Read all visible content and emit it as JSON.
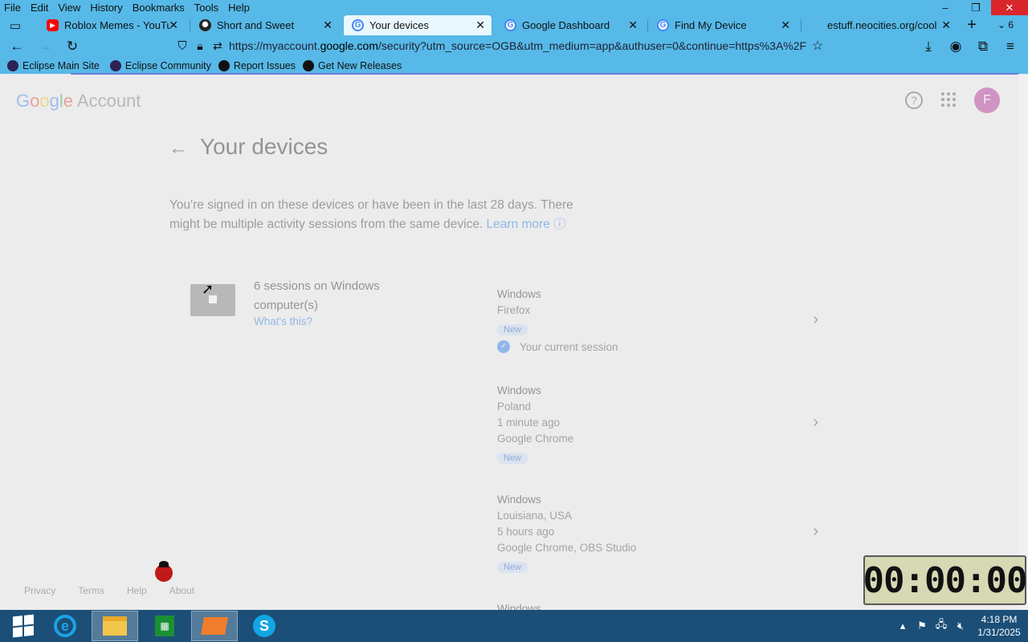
{
  "menubar": [
    "File",
    "Edit",
    "View",
    "History",
    "Bookmarks",
    "Tools",
    "Help"
  ],
  "window_controls": {
    "minimize": "–",
    "restore": "❐",
    "close": "✕"
  },
  "tabs": [
    {
      "label": "Roblox Memes - YouTube",
      "icon": "youtube-icon"
    },
    {
      "label": "Short and Sweet",
      "icon": "ai-icon"
    },
    {
      "label": "Your devices",
      "icon": "google-icon",
      "active": true
    },
    {
      "label": "Google Dashboard",
      "icon": "google-icon"
    },
    {
      "label": "Find My Device",
      "icon": "google-icon"
    },
    {
      "label": "estuff.neocities.org/cool",
      "icon": ""
    }
  ],
  "tab_overflow_count": "6",
  "url": {
    "prefix": "https://myaccount.",
    "domain": "google.com",
    "rest": "/security?utm_source=OGB&utm_medium=app&authuser=0&continue=https%3A%2F"
  },
  "bookmarks": [
    "Eclipse Main Site",
    "Eclipse Community",
    "Report Issues",
    "Get New Releases"
  ],
  "page": {
    "logo": {
      "g1": "G",
      "g2": "o",
      "g3": "o",
      "g4": "g",
      "g5": "l",
      "g6": "e",
      "suffix": " Account"
    },
    "help": "?",
    "avatar_letter": "F",
    "title": "Your devices",
    "desc": "You're signed in on these devices or have been in the last 28 days. There might be multiple activity sessions from the same device. ",
    "learn_more": "Learn more",
    "group_title": "6 sessions on Windows computer(s)",
    "whats_this": "What's this?",
    "sessions": [
      {
        "os": "Windows",
        "l1": "Firefox",
        "l2": "",
        "l3": "",
        "badge": "New",
        "current": "Your current session"
      },
      {
        "os": "Windows",
        "l1": "Poland",
        "l2": "1 minute ago",
        "l3": "Google Chrome",
        "badge": "New"
      },
      {
        "os": "Windows",
        "l1": "Louisiana, USA",
        "l2": "5 hours ago",
        "l3": "Google Chrome, OBS Studio",
        "badge": "New"
      },
      {
        "os": "Windows"
      }
    ],
    "footer": [
      "Privacy",
      "Terms",
      "Help",
      "About"
    ]
  },
  "timer": "00:00:00",
  "taskbar": {
    "clock_time": "4:18 PM",
    "clock_date": "1/31/2025",
    "ie_glyph": "e",
    "store_glyph": "▦",
    "skype_glyph": "S"
  }
}
